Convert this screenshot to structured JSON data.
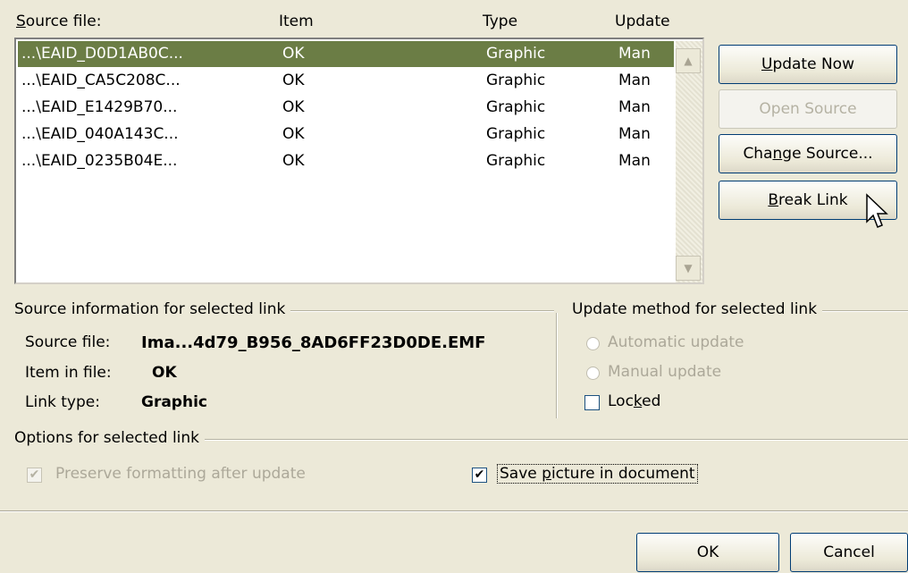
{
  "columns": {
    "source_prefix": "",
    "source_u": "S",
    "source_rest": "ource file:",
    "item": "Item",
    "type": "Type",
    "update": "Update"
  },
  "links": [
    {
      "source": "...\\EAID_D0D1AB0C...",
      "item": "OK",
      "type": "Graphic",
      "update": "Man",
      "selected": true
    },
    {
      "source": "...\\EAID_CA5C208C...",
      "item": "OK",
      "type": "Graphic",
      "update": "Man",
      "selected": false
    },
    {
      "source": "...\\EAID_E1429B70...",
      "item": "OK",
      "type": "Graphic",
      "update": "Man",
      "selected": false
    },
    {
      "source": "...\\EAID_040A143C...",
      "item": "OK",
      "type": "Graphic",
      "update": "Man",
      "selected": false
    },
    {
      "source": "...\\EAID_0235B04E...",
      "item": "OK",
      "type": "Graphic",
      "update": "Man",
      "selected": false
    }
  ],
  "buttons": {
    "update_now": {
      "u": "U",
      "rest": "pdate Now"
    },
    "open_source": "Open Source",
    "change_source": {
      "pre": "Cha",
      "u": "n",
      "rest": "ge Source..."
    },
    "break_link": {
      "u": "B",
      "rest": "reak Link"
    },
    "ok": "OK",
    "cancel": "Cancel"
  },
  "source_info": {
    "group_label": "Source information for selected link",
    "source_file_label": "Source file:",
    "source_file_value": "Ima...4d79_B956_8AD6FF23D0DE.EMF",
    "item_label": "Item in file:",
    "item_value": "OK",
    "link_type_label": "Link type:",
    "link_type_value": "Graphic"
  },
  "update_method": {
    "group_label": "Update method for selected link",
    "automatic": "Automatic update",
    "manual": "Manual update",
    "locked_pre": "Loc",
    "locked_u": "k",
    "locked_rest": "ed",
    "locked_checked": false
  },
  "options": {
    "group_label": "Options for selected link",
    "preserve": "Preserve formatting after update",
    "preserve_checked": true,
    "save_pre": "Save ",
    "save_u": "p",
    "save_rest": "icture in document",
    "save_checked": true
  },
  "icons": {
    "scroll_up": "▲",
    "scroll_down": "▼",
    "check": "✔"
  }
}
